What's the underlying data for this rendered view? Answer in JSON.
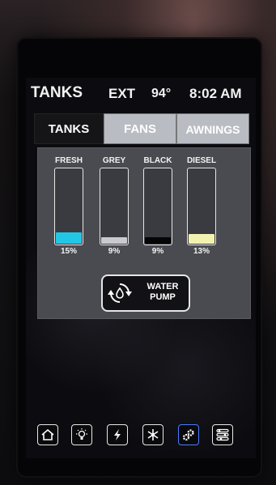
{
  "header": {
    "title": "TANKS",
    "ext_label": "EXT",
    "temperature": "94°",
    "time": "8:02 AM"
  },
  "tabs": [
    {
      "label": "TANKS",
      "selected": true
    },
    {
      "label": "FANS",
      "selected": false
    },
    {
      "label": "AWNINGS",
      "selected": false
    }
  ],
  "tanks": [
    {
      "label": "FRESH",
      "percent_text": "15%",
      "level": 0.15,
      "color": "#22c7e6"
    },
    {
      "label": "GREY",
      "percent_text": "9%",
      "level": 0.09,
      "color": "#c9c9cf"
    },
    {
      "label": "BLACK",
      "percent_text": "9%",
      "level": 0.09,
      "color": "#050505"
    },
    {
      "label": "DIESEL",
      "percent_text": "13%",
      "level": 0.13,
      "color": "#f2f2b0"
    }
  ],
  "pump_button": {
    "line1": "WATER",
    "line2": "PUMP"
  },
  "nav": [
    {
      "icon": "home-icon"
    },
    {
      "icon": "light-bulb-icon"
    },
    {
      "icon": "lightning-icon"
    },
    {
      "icon": "snowflake-icon"
    },
    {
      "icon": "gears-icon",
      "active": true
    },
    {
      "icon": "settings-sliders-icon"
    }
  ],
  "colors": {
    "accent_active": "#4d7bff",
    "panel": "#4a4b51"
  }
}
